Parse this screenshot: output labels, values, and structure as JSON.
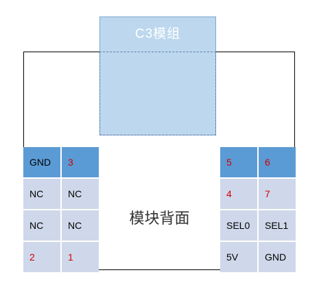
{
  "module": {
    "label": "C3模组"
  },
  "board": {
    "label": "模块背面"
  },
  "left_header": {
    "rows": [
      [
        "GND",
        "3"
      ],
      [
        "NC",
        "NC"
      ],
      [
        "NC",
        "NC"
      ],
      [
        "2",
        "1"
      ]
    ]
  },
  "right_header": {
    "rows": [
      [
        "5",
        "6"
      ],
      [
        "4",
        "7"
      ],
      [
        "SEL0",
        "SEL1"
      ],
      [
        "5V",
        "GND"
      ]
    ]
  },
  "colors": {
    "module_fill": "#bdd7ee",
    "top_row_fill": "#5b9bd5",
    "pin_fill": "#cfd8ea",
    "pin_number_red": "#d00000"
  }
}
